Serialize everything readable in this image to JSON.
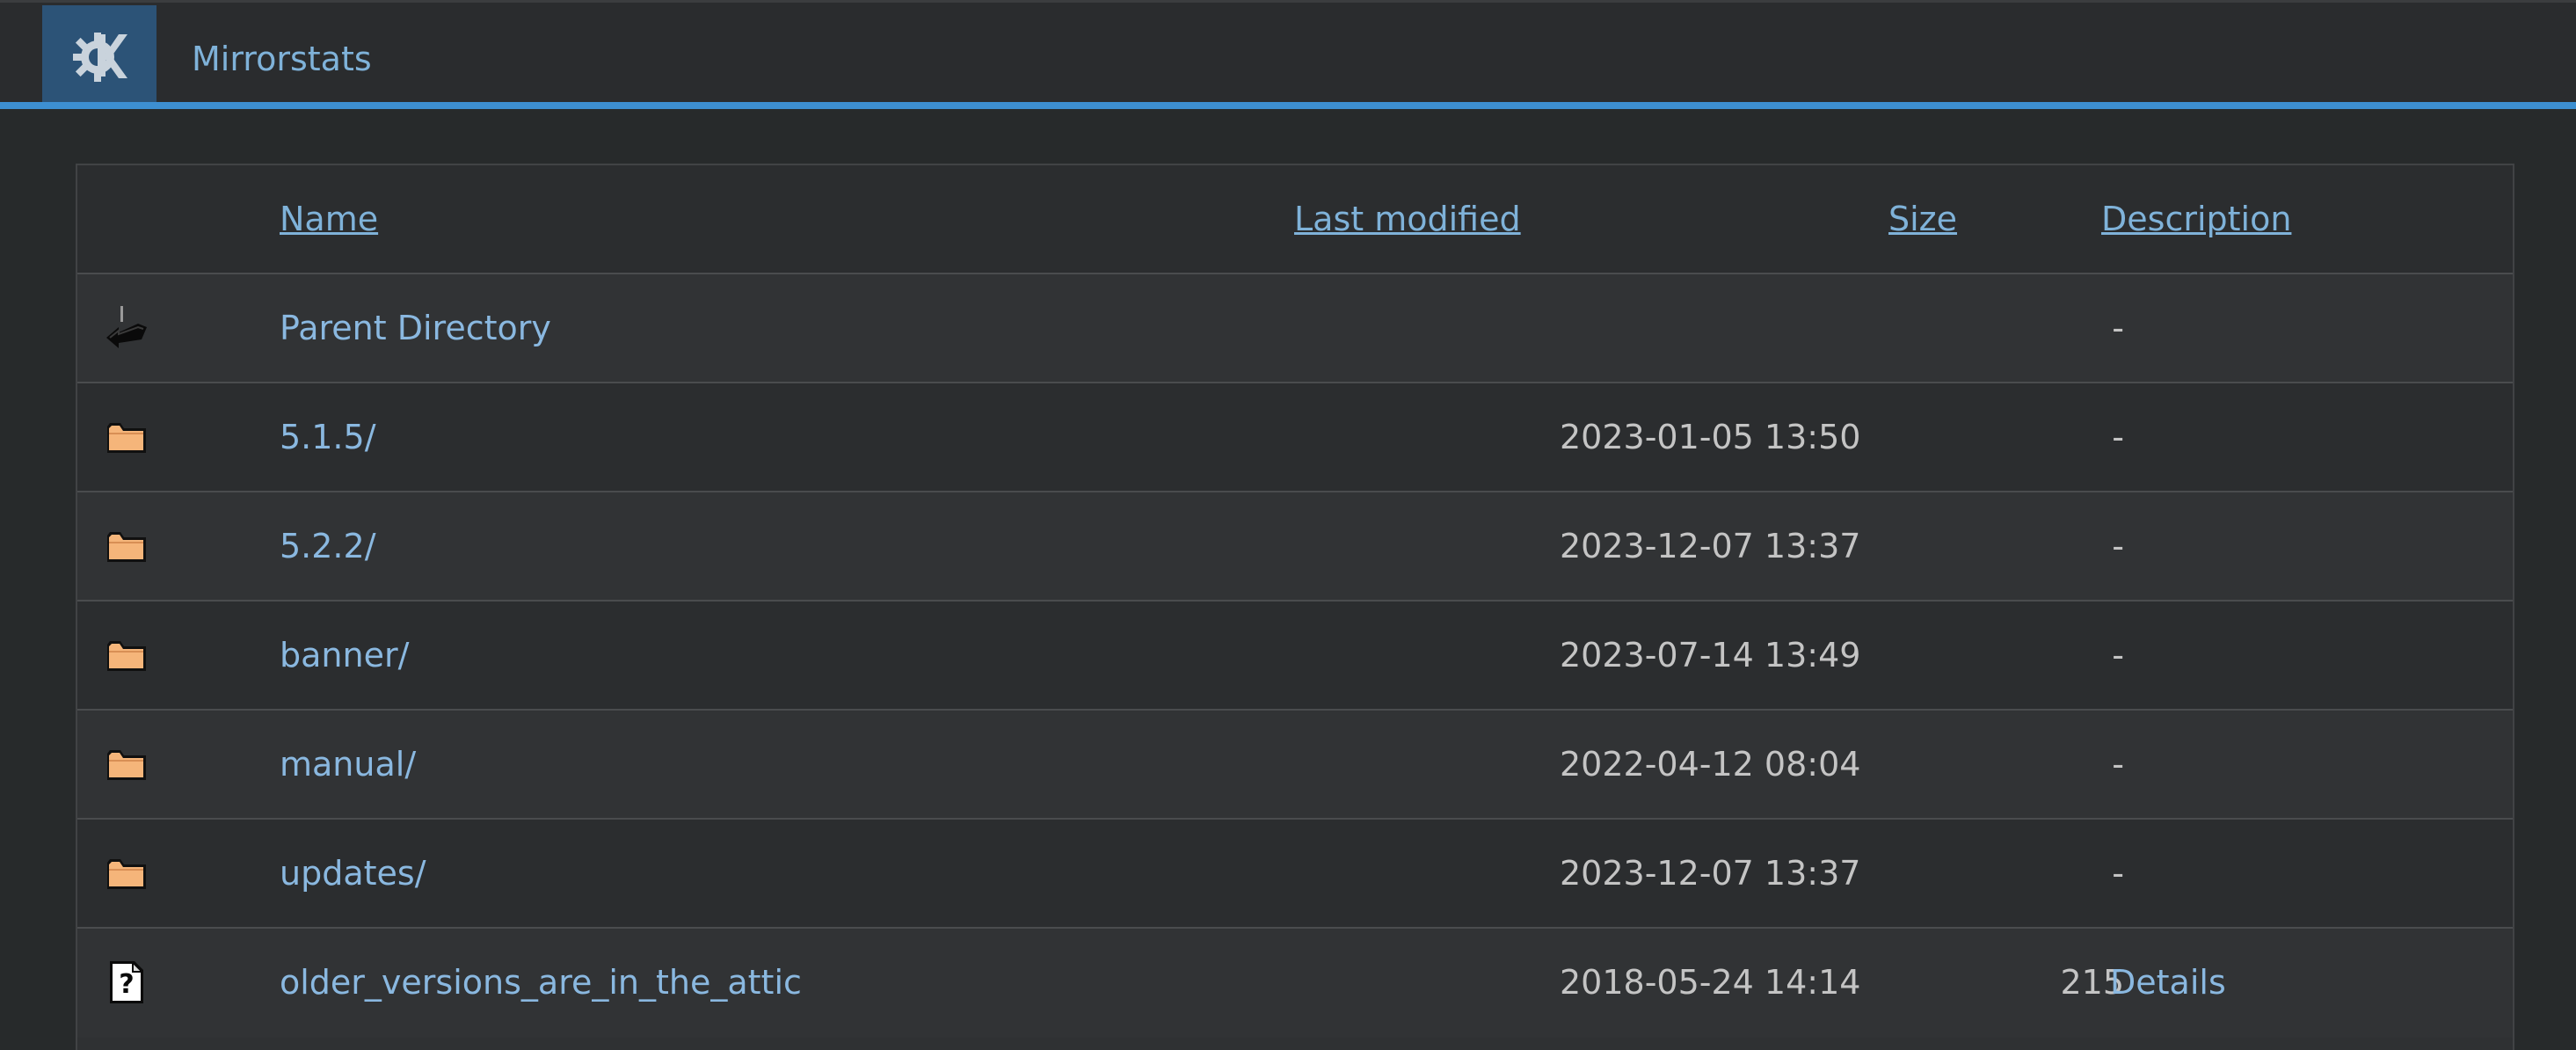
{
  "site": {
    "title": "Mirrorstats",
    "logo": "kde-gear-k-logo"
  },
  "listing": {
    "columns": {
      "name": "Name",
      "last_modified": "Last modified",
      "size": "Size",
      "description": "Description"
    },
    "rows": [
      {
        "icon": "back-arrow-icon",
        "name": "Parent Directory",
        "date": "",
        "size": "-",
        "description": ""
      },
      {
        "icon": "folder-icon",
        "name": "5.1.5/",
        "date": "2023-01-05 13:50",
        "size": "-",
        "description": ""
      },
      {
        "icon": "folder-icon",
        "name": "5.2.2/",
        "date": "2023-12-07 13:37",
        "size": "-",
        "description": ""
      },
      {
        "icon": "folder-icon",
        "name": "banner/",
        "date": "2023-07-14 13:49",
        "size": "-",
        "description": ""
      },
      {
        "icon": "folder-icon",
        "name": "manual/",
        "date": "2022-04-12 08:04",
        "size": "-",
        "description": ""
      },
      {
        "icon": "folder-icon",
        "name": "updates/",
        "date": "2023-12-07 13:37",
        "size": "-",
        "description": ""
      },
      {
        "icon": "unknown-file-icon",
        "name": "older_versions_are_in_the_attic",
        "date": "2018-05-24 14:14",
        "size": "215",
        "description": "Details"
      }
    ]
  },
  "colors": {
    "accent": "#3d8fd1",
    "link": "#8ab8e0",
    "background": "#272a2b",
    "folder": "#f5b57a"
  }
}
